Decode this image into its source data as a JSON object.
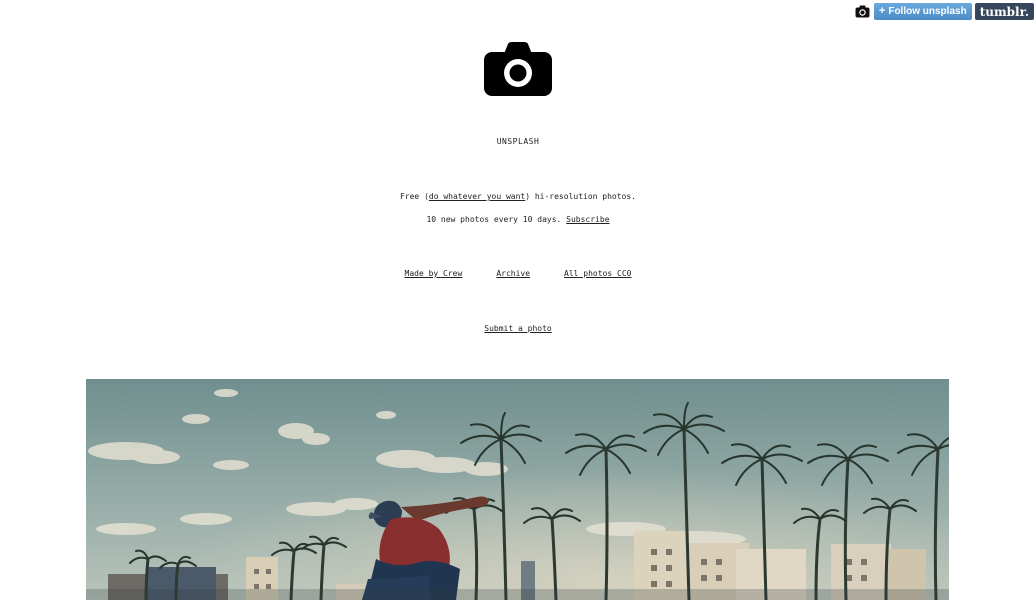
{
  "tumblr_controls": {
    "camera_icon": "camera-icon",
    "follow_plus": "+",
    "follow_label": "Follow unsplash",
    "brand_label": "tumblr."
  },
  "header": {
    "logo_icon": "camera-icon",
    "site_title": "UNSPLASH"
  },
  "intro": {
    "tagline_prefix": "Free (",
    "tagline_link": "do whatever you want",
    "tagline_suffix": ") hi-resolution photos.",
    "schedule_text": "10 new photos every 10 days.",
    "subscribe_link": "Subscribe"
  },
  "nav": {
    "links": [
      "Made by Crew",
      "Archive",
      "All photos CC0"
    ],
    "submit_link": "Submit a photo"
  },
  "colors": {
    "tumblr_follow": "#5b9bd5",
    "tumblr_brand": "#36465d",
    "photo_sky": "#8fa9a9"
  }
}
